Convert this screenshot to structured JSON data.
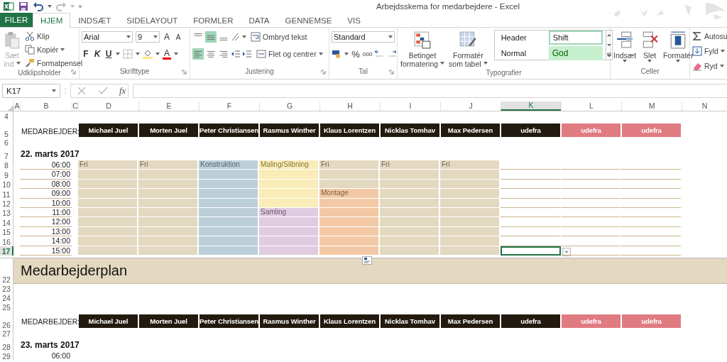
{
  "window": {
    "title": "Arbejdsskema for medarbejdere - Excel"
  },
  "tabs": [
    {
      "label": "FILER",
      "kind": "file",
      "selected": false
    },
    {
      "label": "HJEM",
      "kind": "tab",
      "selected": true
    },
    {
      "label": "INDSÆT",
      "kind": "tab",
      "selected": false
    },
    {
      "label": "SIDELAYOUT",
      "kind": "tab",
      "selected": false
    },
    {
      "label": "FORMLER",
      "kind": "tab",
      "selected": false
    },
    {
      "label": "DATA",
      "kind": "tab",
      "selected": false
    },
    {
      "label": "GENNEMSE",
      "kind": "tab",
      "selected": false
    },
    {
      "label": "VIS",
      "kind": "tab",
      "selected": false
    }
  ],
  "clipboard": {
    "paste_top": "Sæt",
    "paste_bottom": "ind",
    "paste_disabled": true,
    "cut": "Klip",
    "copy": "Kopiér",
    "format_painter": "Formatpensel",
    "group": "Udklipsholder"
  },
  "font": {
    "name": "Arial",
    "size": "9",
    "grow": "A",
    "shrink": "A",
    "bold": "F",
    "italic": "K",
    "underline": "U",
    "font_color": "A",
    "group": "Skrifttype"
  },
  "alignment": {
    "vertical": [
      {
        "selected": false
      },
      {
        "selected": true
      },
      {
        "selected": false
      }
    ],
    "horizontal": [
      {
        "selected": true
      },
      {
        "selected": false
      },
      {
        "selected": false
      }
    ],
    "wrap": "Ombryd tekst",
    "merge": "Flet og centrer",
    "group": "Justering"
  },
  "number": {
    "format": "Standard",
    "percent": "%",
    "thousands": "000",
    "group": "Tal"
  },
  "styles": {
    "conditional_top": "Betinget",
    "conditional_bottom": "formatering",
    "table_top": "Formatér",
    "table_bottom": "som tabel",
    "gallery": [
      {
        "label": "Header",
        "kind": "plain",
        "selected": false
      },
      {
        "label": "Shift",
        "kind": "plain",
        "selected": true
      },
      {
        "label": "Normal",
        "kind": "plain",
        "selected": false
      },
      {
        "label": "God",
        "kind": "good",
        "selected": false
      }
    ],
    "group": "Typografier"
  },
  "cells_group": {
    "insert": "Indsæt",
    "delete": "Slet",
    "format": "Formatér",
    "group": "Celler"
  },
  "editing": {
    "autosum": "Autosu",
    "fill": "Fyld",
    "clear": "Ryd"
  },
  "formula_bar": {
    "name_box": "K17",
    "fx": "fx"
  },
  "columns": [
    {
      "label": "A",
      "selected": false
    },
    {
      "label": "B",
      "selected": false
    },
    {
      "label": "C",
      "selected": false
    },
    {
      "label": "D",
      "selected": false
    },
    {
      "label": "E",
      "selected": false
    },
    {
      "label": "F",
      "selected": false
    },
    {
      "label": "G",
      "selected": false
    },
    {
      "label": "H",
      "selected": false
    },
    {
      "label": "I",
      "selected": false
    },
    {
      "label": "J",
      "selected": false
    },
    {
      "label": "K",
      "selected": true
    },
    {
      "label": "L",
      "selected": false
    },
    {
      "label": "M",
      "selected": false
    },
    {
      "label": "N",
      "selected": false
    }
  ],
  "rows": [
    {
      "number": "4",
      "kind": "blank",
      "selected": false
    },
    {
      "number": "5",
      "kind": "employees",
      "selected": false,
      "label": "MEDARBEJDER:",
      "employees": [
        {
          "name": "Michael Juel",
          "color": "#231a0f"
        },
        {
          "name": "Morten Juel",
          "color": "#231a0f"
        },
        {
          "name": "Peter Christiansen",
          "color": "#231a0f"
        },
        {
          "name": "Rasmus Winther",
          "color": "#231a0f"
        },
        {
          "name": "Klaus Lorentzen",
          "color": "#231a0f"
        },
        {
          "name": "Nicklas Tomhav",
          "color": "#231a0f"
        },
        {
          "name": "Max Pedersen",
          "color": "#231a0f"
        },
        {
          "name": "udefra",
          "color": "#231a0f"
        },
        {
          "name": "udefra",
          "color": "#e07b82"
        },
        {
          "name": "udefra",
          "color": "#e07b82"
        }
      ]
    },
    {
      "number": "6",
      "kind": "spacer",
      "selected": false
    },
    {
      "number": "7",
      "kind": "date",
      "selected": false,
      "text": "22. marts 2017"
    },
    {
      "number": "8",
      "kind": "time",
      "selected": false,
      "time": "06:00",
      "cells": [
        {
          "kind": "filled",
          "color": "#e3d8c0",
          "text": "Fri"
        },
        {
          "kind": "filled",
          "color": "#e3d8c0",
          "text": "Fri"
        },
        {
          "kind": "filled",
          "color": "#bccfd8",
          "text": "Konstruktion"
        },
        {
          "kind": "filled",
          "color": "#f9ecb8",
          "text": "Maling/Slibning"
        },
        {
          "kind": "filled",
          "color": "#e3d8c0",
          "text": "Fri"
        },
        {
          "kind": "filled",
          "color": "#e3d8c0",
          "text": "Fri"
        },
        {
          "kind": "filled",
          "color": "#e3d8c0",
          "text": "Fri"
        },
        {
          "kind": "empty"
        },
        {
          "kind": "empty"
        },
        {
          "kind": "empty"
        }
      ]
    },
    {
      "number": "9",
      "kind": "time",
      "selected": false,
      "time": "07:00",
      "cells": [
        {
          "kind": "filled",
          "color": "#e3d8c0"
        },
        {
          "kind": "filled",
          "color": "#e3d8c0"
        },
        {
          "kind": "filled",
          "color": "#bccfd8"
        },
        {
          "kind": "filled",
          "color": "#f9ecb8"
        },
        {
          "kind": "filled",
          "color": "#e3d8c0"
        },
        {
          "kind": "filled",
          "color": "#e3d8c0"
        },
        {
          "kind": "filled",
          "color": "#e3d8c0"
        },
        {
          "kind": "empty"
        },
        {
          "kind": "empty"
        },
        {
          "kind": "empty"
        }
      ]
    },
    {
      "number": "10",
      "kind": "time",
      "selected": false,
      "time": "08:00",
      "cells": [
        {
          "kind": "filled",
          "color": "#e3d8c0"
        },
        {
          "kind": "filled",
          "color": "#e3d8c0"
        },
        {
          "kind": "filled",
          "color": "#bccfd8"
        },
        {
          "kind": "filled",
          "color": "#f9ecb8"
        },
        {
          "kind": "filled",
          "color": "#e3d8c0"
        },
        {
          "kind": "filled",
          "color": "#e3d8c0"
        },
        {
          "kind": "filled",
          "color": "#e3d8c0"
        },
        {
          "kind": "empty"
        },
        {
          "kind": "empty"
        },
        {
          "kind": "empty"
        }
      ]
    },
    {
      "number": "11",
      "kind": "time",
      "selected": false,
      "time": "09:00",
      "cells": [
        {
          "kind": "filled",
          "color": "#e3d8c0"
        },
        {
          "kind": "filled",
          "color": "#e3d8c0"
        },
        {
          "kind": "filled",
          "color": "#bccfd8"
        },
        {
          "kind": "filled",
          "color": "#f9ecb8"
        },
        {
          "kind": "filled",
          "color": "#f3c9a5",
          "text": "Montage"
        },
        {
          "kind": "filled",
          "color": "#e3d8c0"
        },
        {
          "kind": "filled",
          "color": "#e3d8c0"
        },
        {
          "kind": "empty"
        },
        {
          "kind": "empty"
        },
        {
          "kind": "empty"
        }
      ]
    },
    {
      "number": "12",
      "kind": "time",
      "selected": false,
      "time": "10:00",
      "cells": [
        {
          "kind": "filled",
          "color": "#e3d8c0"
        },
        {
          "kind": "filled",
          "color": "#e3d8c0"
        },
        {
          "kind": "filled",
          "color": "#bccfd8"
        },
        {
          "kind": "filled",
          "color": "#f9ecb8"
        },
        {
          "kind": "filled",
          "color": "#f3c9a5"
        },
        {
          "kind": "filled",
          "color": "#e3d8c0"
        },
        {
          "kind": "filled",
          "color": "#e3d8c0"
        },
        {
          "kind": "empty"
        },
        {
          "kind": "empty"
        },
        {
          "kind": "empty"
        }
      ]
    },
    {
      "number": "13",
      "kind": "time",
      "selected": false,
      "time": "11:00",
      "cells": [
        {
          "kind": "filled",
          "color": "#e3d8c0"
        },
        {
          "kind": "filled",
          "color": "#e3d8c0"
        },
        {
          "kind": "filled",
          "color": "#bccfd8"
        },
        {
          "kind": "filled",
          "color": "#e0cce0",
          "text": "Samling"
        },
        {
          "kind": "filled",
          "color": "#f3c9a5"
        },
        {
          "kind": "filled",
          "color": "#e3d8c0"
        },
        {
          "kind": "filled",
          "color": "#e3d8c0"
        },
        {
          "kind": "empty"
        },
        {
          "kind": "empty"
        },
        {
          "kind": "empty"
        }
      ]
    },
    {
      "number": "14",
      "kind": "time",
      "selected": false,
      "time": "12:00",
      "cells": [
        {
          "kind": "filled",
          "color": "#e3d8c0"
        },
        {
          "kind": "filled",
          "color": "#e3d8c0"
        },
        {
          "kind": "filled",
          "color": "#bccfd8"
        },
        {
          "kind": "filled",
          "color": "#e0cce0"
        },
        {
          "kind": "filled",
          "color": "#f3c9a5"
        },
        {
          "kind": "filled",
          "color": "#e3d8c0"
        },
        {
          "kind": "filled",
          "color": "#e3d8c0"
        },
        {
          "kind": "empty"
        },
        {
          "kind": "empty"
        },
        {
          "kind": "empty"
        }
      ]
    },
    {
      "number": "15",
      "kind": "time",
      "selected": false,
      "time": "13:00",
      "cells": [
        {
          "kind": "filled",
          "color": "#e3d8c0"
        },
        {
          "kind": "filled",
          "color": "#e3d8c0"
        },
        {
          "kind": "filled",
          "color": "#bccfd8"
        },
        {
          "kind": "filled",
          "color": "#e0cce0"
        },
        {
          "kind": "filled",
          "color": "#f3c9a5"
        },
        {
          "kind": "filled",
          "color": "#e3d8c0"
        },
        {
          "kind": "filled",
          "color": "#e3d8c0"
        },
        {
          "kind": "empty"
        },
        {
          "kind": "empty"
        },
        {
          "kind": "empty"
        }
      ]
    },
    {
      "number": "16",
      "kind": "time",
      "selected": false,
      "time": "14:00",
      "cells": [
        {
          "kind": "filled",
          "color": "#e3d8c0"
        },
        {
          "kind": "filled",
          "color": "#e3d8c0"
        },
        {
          "kind": "filled",
          "color": "#bccfd8"
        },
        {
          "kind": "filled",
          "color": "#e0cce0"
        },
        {
          "kind": "filled",
          "color": "#f3c9a5"
        },
        {
          "kind": "filled",
          "color": "#e3d8c0"
        },
        {
          "kind": "filled",
          "color": "#e3d8c0"
        },
        {
          "kind": "empty"
        },
        {
          "kind": "empty"
        },
        {
          "kind": "empty"
        }
      ]
    },
    {
      "number": "17",
      "kind": "time",
      "selected": true,
      "time": "15:00",
      "cells": [
        {
          "kind": "filled",
          "color": "#e3d8c0"
        },
        {
          "kind": "filled",
          "color": "#e3d8c0"
        },
        {
          "kind": "filled",
          "color": "#bccfd8"
        },
        {
          "kind": "filled",
          "color": "#e0cce0"
        },
        {
          "kind": "filled",
          "color": "#f3c9a5"
        },
        {
          "kind": "filled",
          "color": "#e3d8c0"
        },
        {
          "kind": "filled",
          "color": "#e3d8c0"
        },
        {
          "kind": "empty"
        },
        {
          "kind": "empty"
        },
        {
          "kind": "empty"
        }
      ]
    },
    {
      "number": "22",
      "kind": "banner",
      "selected": false,
      "text": "Medarbejderplan"
    },
    {
      "number": "23",
      "kind": "blank",
      "selected": false
    },
    {
      "number": "24",
      "kind": "blank",
      "selected": false
    },
    {
      "number": "25",
      "kind": "blank",
      "selected": false
    },
    {
      "number": "26",
      "kind": "employees",
      "selected": false,
      "label": "MEDARBEJDER:",
      "employees": [
        {
          "name": "Michael Juel",
          "color": "#231a0f"
        },
        {
          "name": "Morten Juel",
          "color": "#231a0f"
        },
        {
          "name": "Peter Christiansen",
          "color": "#231a0f"
        },
        {
          "name": "Rasmus Winther",
          "color": "#231a0f"
        },
        {
          "name": "Klaus Lorentzen",
          "color": "#231a0f"
        },
        {
          "name": "Nicklas Tomhav",
          "color": "#231a0f"
        },
        {
          "name": "Max Pedersen",
          "color": "#231a0f"
        },
        {
          "name": "udefra",
          "color": "#231a0f"
        },
        {
          "name": "udefra",
          "color": "#e07b82"
        },
        {
          "name": "udefra",
          "color": "#e07b82"
        }
      ]
    },
    {
      "number": "27",
      "kind": "spacer",
      "selected": false
    },
    {
      "number": "28",
      "kind": "date",
      "selected": false,
      "text": "23. marts 2017"
    },
    {
      "number": "29",
      "kind": "time",
      "selected": false,
      "time": "06:00"
    }
  ]
}
